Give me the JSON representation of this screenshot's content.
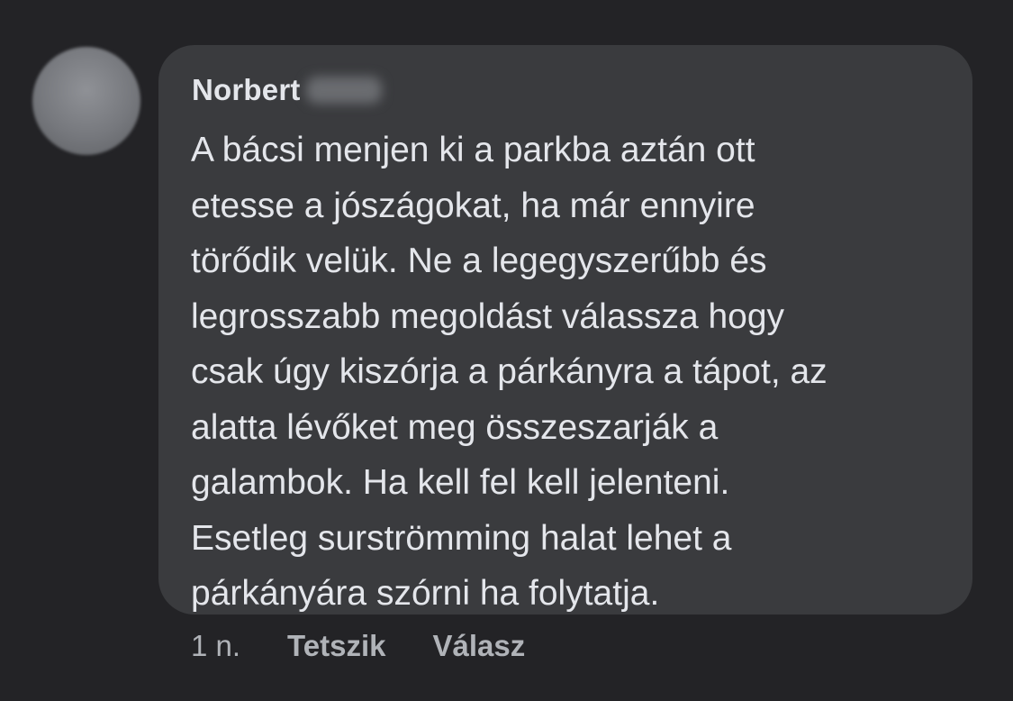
{
  "comment": {
    "author": "Norbert",
    "author_surname_blurred": "",
    "text_lines": [
      "A bácsi menjen ki a parkba aztán ott",
      "etesse a jószágokat, ha már ennyire",
      "törődik velük. Ne a legegyszerűbb és",
      "legrosszabb megoldást válassza hogy",
      "csak úgy kiszórja a párkányra a tápot, az",
      "alatta lévőket meg összeszarják a",
      "galambok. Ha kell fel kell jelenteni.",
      "Esetleg surströmming halat lehet a",
      "párkányára szórni ha folytatja."
    ],
    "time": "1 n.",
    "like_label": "Tetszik",
    "reply_label": "Válasz"
  },
  "colors": {
    "background": "#232326",
    "bubble": "#3a3b3e",
    "text": "#e4e6eb",
    "secondary_text": "#b0b3b8"
  }
}
